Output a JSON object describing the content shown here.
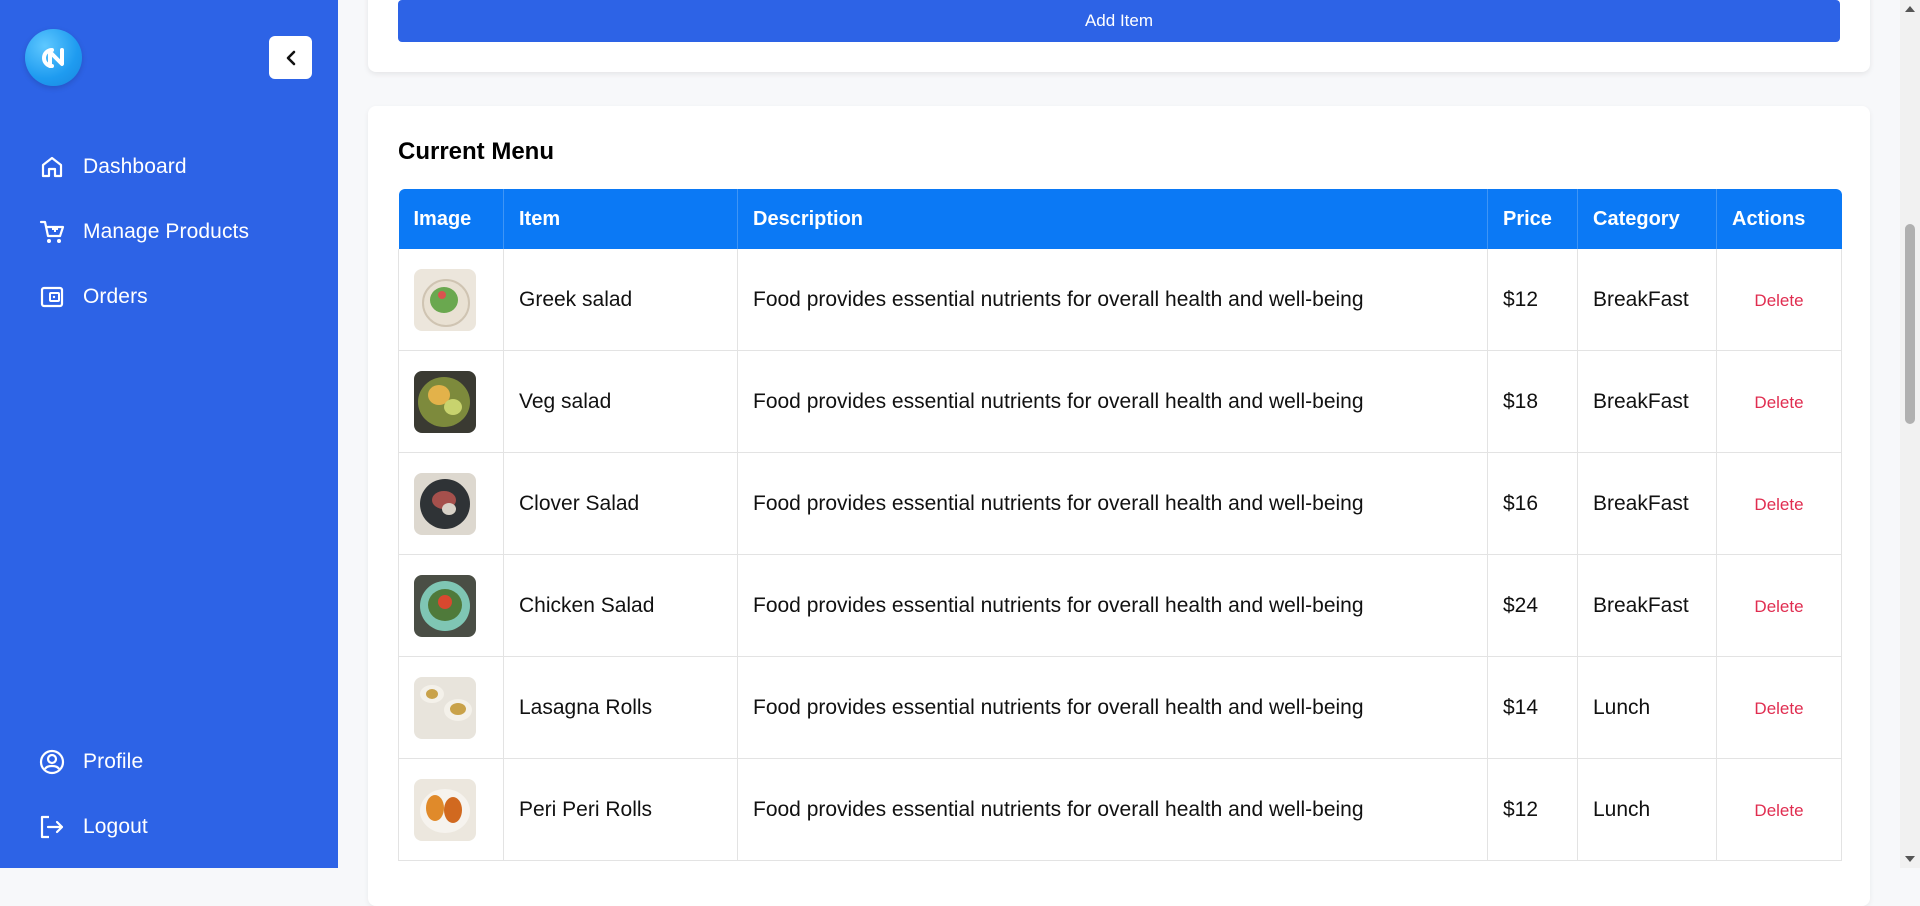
{
  "sidebar": {
    "logo_text": "CN",
    "items": [
      {
        "label": "Dashboard",
        "icon": "home-icon"
      },
      {
        "label": "Manage Products",
        "icon": "cart-icon"
      },
      {
        "label": "Orders",
        "icon": "wallet-icon"
      }
    ],
    "bottom_items": [
      {
        "label": "Profile",
        "icon": "user-circle-icon"
      },
      {
        "label": "Logout",
        "icon": "logout-icon"
      }
    ]
  },
  "form": {
    "add_button_label": "Add Item"
  },
  "menu": {
    "title": "Current Menu",
    "columns": [
      "Image",
      "Item",
      "Description",
      "Price",
      "Category",
      "Actions"
    ],
    "rows": [
      {
        "name": "Greek salad",
        "description": "Food provides essential nutrients for overall health and well-being",
        "price": "$12",
        "category": "BreakFast",
        "action": "Delete"
      },
      {
        "name": "Veg salad",
        "description": "Food provides essential nutrients for overall health and well-being",
        "price": "$18",
        "category": "BreakFast",
        "action": "Delete"
      },
      {
        "name": "Clover Salad",
        "description": "Food provides essential nutrients for overall health and well-being",
        "price": "$16",
        "category": "BreakFast",
        "action": "Delete"
      },
      {
        "name": "Chicken Salad",
        "description": "Food provides essential nutrients for overall health and well-being",
        "price": "$24",
        "category": "BreakFast",
        "action": "Delete"
      },
      {
        "name": "Lasagna Rolls",
        "description": "Food provides essential nutrients for overall health and well-being",
        "price": "$14",
        "category": "Lunch",
        "action": "Delete"
      },
      {
        "name": "Peri Peri Rolls",
        "description": "Food provides essential nutrients for overall health and well-being",
        "price": "$12",
        "category": "Lunch",
        "action": "Delete"
      }
    ]
  },
  "colors": {
    "sidebar_bg": "#2d63e6",
    "table_header": "#0b79f5",
    "delete_text": "#e02d50"
  }
}
